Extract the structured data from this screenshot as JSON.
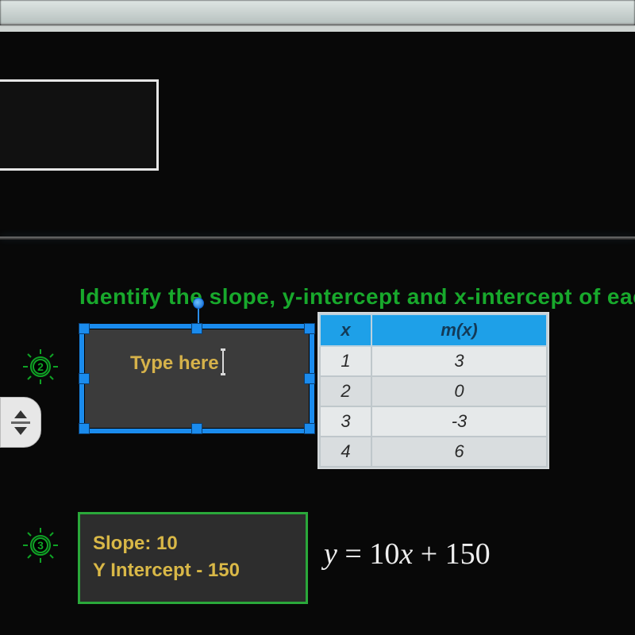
{
  "instruction": "Identify the slope, y-intercept and x-intercept of eac",
  "selected_textbox": {
    "placeholder": "Type here"
  },
  "bulbs": {
    "two": "2",
    "three": "3"
  },
  "table": {
    "headers": {
      "x": "x",
      "fx": "m(x)"
    },
    "rows": [
      {
        "x": "1",
        "fx": "3"
      },
      {
        "x": "2",
        "fx": "0"
      },
      {
        "x": "3",
        "fx": "-3"
      },
      {
        "x": "4",
        "fx": "6"
      }
    ]
  },
  "answer": {
    "line1": "Slope: 10",
    "line2": "Y Intercept - 150"
  },
  "equation": {
    "lhs": "y",
    "eq": "=",
    "rhs_a": "10",
    "rhs_var": "x",
    "rhs_plus": "+",
    "rhs_b": "150"
  }
}
